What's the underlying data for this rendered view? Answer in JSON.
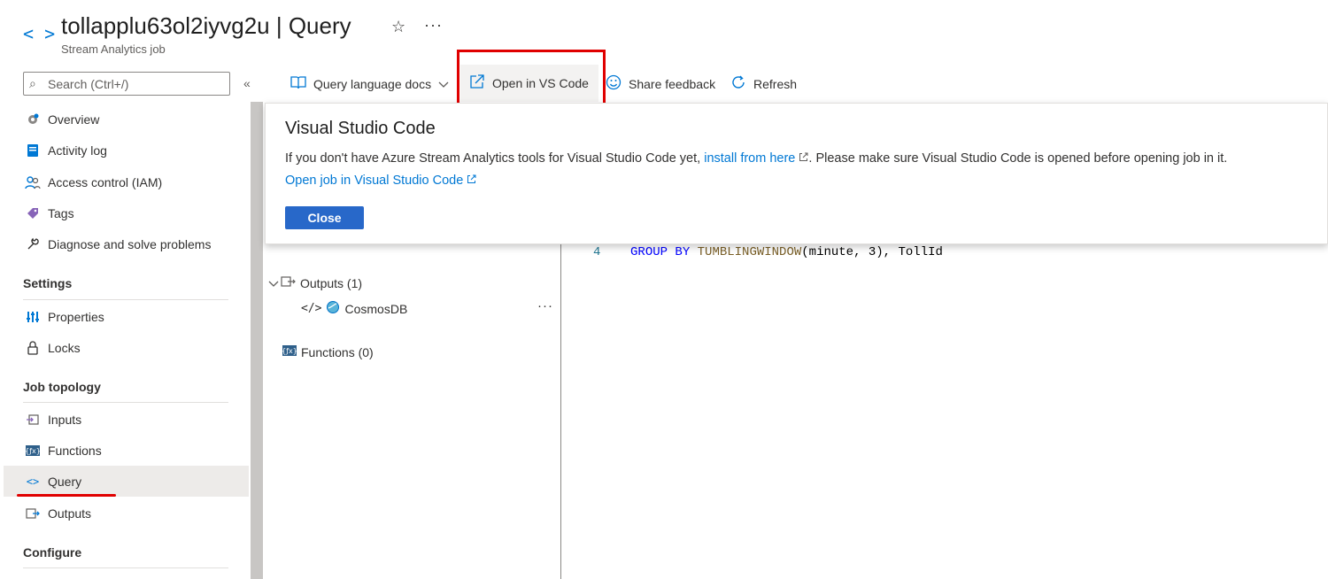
{
  "header": {
    "title": "tollapplu63ol2iyvg2u | Query",
    "subtitle": "Stream Analytics job",
    "star_glyph": "☆",
    "more_glyph": "···"
  },
  "sidebar": {
    "search_placeholder": "Search (Ctrl+/)",
    "collapse_glyph": "«",
    "items_top": [
      {
        "label": "Overview",
        "icon": "overview-gear-icon"
      },
      {
        "label": "Activity log",
        "icon": "activity-log-icon"
      },
      {
        "label": "Access control (IAM)",
        "icon": "people-icon"
      },
      {
        "label": "Tags",
        "icon": "tag-icon"
      },
      {
        "label": "Diagnose and solve problems",
        "icon": "wrench-icon"
      }
    ],
    "section_settings": "Settings",
    "items_settings": [
      {
        "label": "Properties",
        "icon": "properties-icon"
      },
      {
        "label": "Locks",
        "icon": "lock-icon"
      }
    ],
    "section_job_topology": "Job topology",
    "items_topology": [
      {
        "label": "Inputs",
        "icon": "inputs-icon"
      },
      {
        "label": "Functions",
        "icon": "functions-icon"
      },
      {
        "label": "Query",
        "icon": "query-icon",
        "selected": true
      },
      {
        "label": "Outputs",
        "icon": "outputs-icon"
      }
    ],
    "section_configure": "Configure"
  },
  "toolbar": {
    "docs_label": "Query language docs",
    "vscode_label": "Open in VS Code",
    "feedback_label": "Share feedback",
    "refresh_label": "Refresh"
  },
  "tree": {
    "outputs_label": "Outputs (1)",
    "cosmos_label": "CosmosDB",
    "functions_label": "Functions (0)",
    "more_glyph": "···"
  },
  "editor": {
    "line_number": "4",
    "line_tokens": {
      "kw": "GROUP BY",
      "fn": "TUMBLINGWINDOW",
      "args": "(minute, 3), TollId"
    }
  },
  "callout": {
    "title": "Visual Studio Code",
    "body_prefix": "If you don't have Azure Stream Analytics tools for Visual Studio Code yet, ",
    "install_link": "install from here",
    "body_suffix": ". Please make sure Visual Studio Code is opened before opening job in it.",
    "open_link": "Open job in Visual Studio Code",
    "close_label": "Close"
  },
  "colors": {
    "accent": "#0078d4",
    "highlight_red": "#e00000",
    "button_blue": "#2868c9",
    "selected_bg": "#edebe9"
  }
}
